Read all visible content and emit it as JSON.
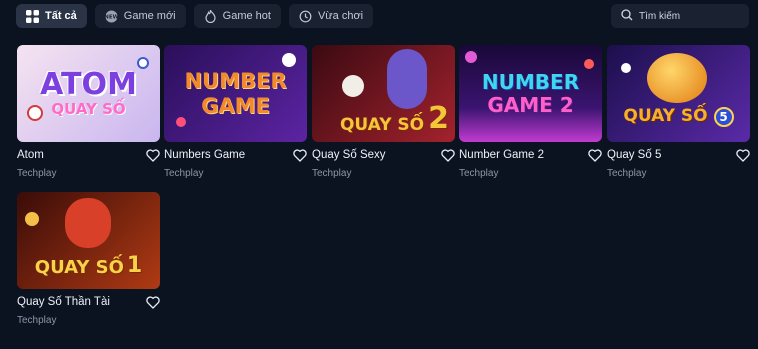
{
  "tabs": [
    {
      "label": "Tất cả",
      "icon": "grid-icon",
      "active": true
    },
    {
      "label": "Game mới",
      "icon": "new-badge-icon",
      "active": false
    },
    {
      "label": "Game hot",
      "icon": "flame-icon",
      "active": false
    },
    {
      "label": "Vừa chơi",
      "icon": "history-icon",
      "active": false
    }
  ],
  "search": {
    "label": "Tìm kiếm",
    "icon": "search-icon"
  },
  "games": [
    {
      "title": "Atom",
      "provider": "Techplay",
      "logo_line1": "ATOM",
      "logo_line2": "QUAY SỐ",
      "colors": {
        "bg": "#f2d7ec",
        "text": "#8a4fe0"
      }
    },
    {
      "title": "Numbers Game",
      "provider": "Techplay",
      "logo_line1": "NUMBER",
      "logo_line2": "GAME",
      "colors": {
        "bg": "#4a1d86",
        "text": "#f08a2c"
      }
    },
    {
      "title": "Quay Số Sexy",
      "provider": "Techplay",
      "logo_line1": "QUAY SỐ",
      "logo_line2": "2",
      "colors": {
        "bg": "#7a1420",
        "text": "#f4c53b"
      }
    },
    {
      "title": "Number Game 2",
      "provider": "Techplay",
      "logo_line1": "NUMBER",
      "logo_line2": "GAME 2",
      "colors": {
        "bg": "#2b1250",
        "text": "#3fd6f0"
      }
    },
    {
      "title": "Quay Số 5",
      "provider": "Techplay",
      "logo_line1": "QUAY SỐ",
      "logo_line2": "5",
      "colors": {
        "bg": "#3a1a78",
        "text": "#f6b02a"
      }
    },
    {
      "title": "Quay Số Thần Tài",
      "provider": "Techplay",
      "logo_line1": "QUAY SỐ",
      "logo_line2": "1",
      "colors": {
        "bg": "#7a1e10",
        "text": "#f7d34a"
      }
    }
  ]
}
